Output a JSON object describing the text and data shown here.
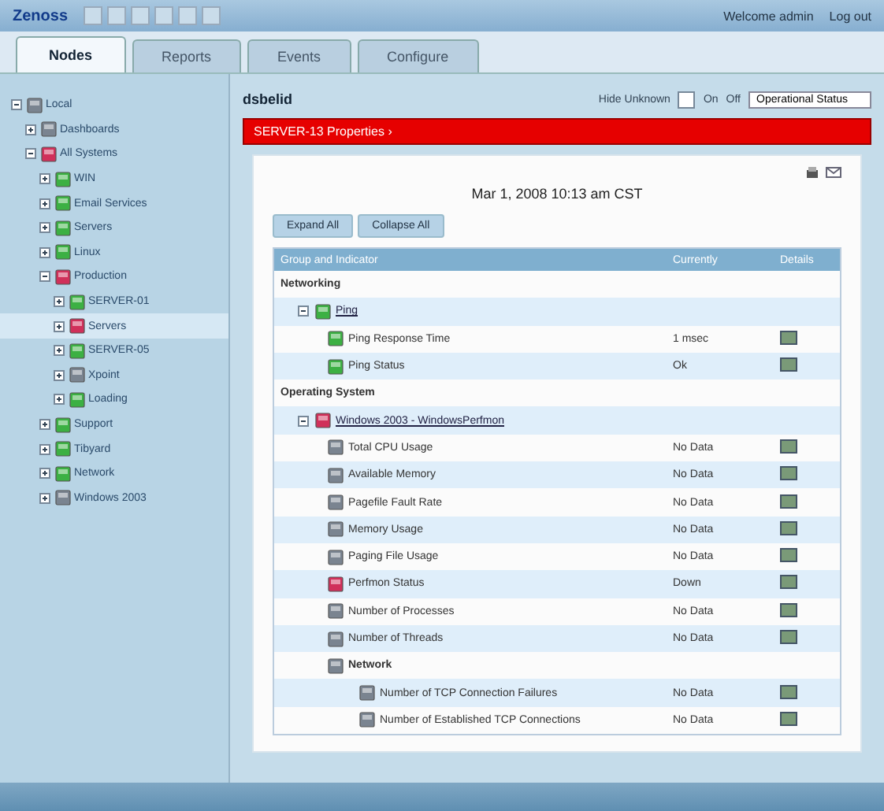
{
  "header": {
    "brand": "Zenoss",
    "user_links": [
      "Welcome admin",
      "Log out"
    ]
  },
  "tabs": [
    {
      "label": "Nodes",
      "selected": true
    },
    {
      "label": "Reports",
      "selected": false
    },
    {
      "label": "Events",
      "selected": false
    },
    {
      "label": "Configure",
      "selected": false
    }
  ],
  "tree": [
    {
      "label": "Local",
      "color": "#7a8490",
      "expanded": true,
      "selected": false,
      "children": [
        {
          "label": "Dashboards",
          "color": "#7a8490",
          "expanded": false,
          "selected": false
        },
        {
          "label": "All Systems",
          "color": "#d0305a",
          "expanded": true,
          "selected": false,
          "children": [
            {
              "label": "WIN",
              "color": "#3cb043",
              "expanded": false,
              "selected": false
            },
            {
              "label": "Email Services",
              "color": "#3cb043",
              "expanded": false,
              "selected": false
            },
            {
              "label": "Servers",
              "color": "#3cb043",
              "expanded": false,
              "selected": false
            },
            {
              "label": "Linux",
              "color": "#3cb043",
              "expanded": false,
              "selected": false
            },
            {
              "label": "Production",
              "color": "#d0305a",
              "expanded": true,
              "selected": false,
              "children": [
                {
                  "label": "SERVER-01",
                  "color": "#3cb043",
                  "expanded": false,
                  "selected": false
                },
                {
                  "label": "Servers",
                  "color": "#d0305a",
                  "expanded": false,
                  "selected": true
                },
                {
                  "label": "SERVER-05",
                  "color": "#3cb043",
                  "expanded": false,
                  "selected": false
                },
                {
                  "label": "Xpoint",
                  "color": "#7a8490",
                  "expanded": false,
                  "selected": false
                },
                {
                  "label": "Loading",
                  "color": "#3cb043",
                  "expanded": false,
                  "selected": false
                }
              ]
            },
            {
              "label": "Support",
              "color": "#3cb043",
              "expanded": false,
              "selected": false
            },
            {
              "label": "Tibyard",
              "color": "#3cb043",
              "expanded": false,
              "selected": false
            },
            {
              "label": "Network",
              "color": "#3cb043",
              "expanded": false,
              "selected": false
            },
            {
              "label": "Windows 2003",
              "color": "#7a8490",
              "expanded": false,
              "selected": false
            }
          ]
        }
      ]
    }
  ],
  "panel": {
    "title": "dsbelid",
    "hide_unknown_label": "Hide Unknown",
    "on_label": "On",
    "off_label": "Off",
    "hide_unknown": false,
    "sort_select": "Operational Status",
    "alert_bar": "SERVER-13  Properties  ›",
    "date": "Mar 1, 2008 10:13 am CST",
    "buttons": [
      "Expand All",
      "Collapse All"
    ],
    "table": {
      "columns": [
        "Group and Indicator",
        "Currently",
        "Details"
      ],
      "rows": [
        {
          "kind": "group",
          "label": "Networking",
          "children": [
            {
              "kind": "host",
              "label": "Ping",
              "color": "#3cb043",
              "expanded": true,
              "children": [
                {
                  "kind": "metric",
                  "label": "Ping Response Time",
                  "color": "#3cb043",
                  "value": "1 msec"
                },
                {
                  "kind": "metric",
                  "label": "Ping Status",
                  "color": "#3cb043",
                  "value": "Ok"
                }
              ]
            }
          ]
        },
        {
          "kind": "group",
          "label": "Operating System",
          "children": [
            {
              "kind": "host",
              "label": "Windows 2003 - WindowsPerfmon",
              "color": "#d0305a",
              "expanded": true,
              "children": [
                {
                  "kind": "metric",
                  "label": "Total CPU Usage",
                  "color": "#7a8490",
                  "value": "No Data"
                },
                {
                  "kind": "metric",
                  "label": "Available Memory",
                  "color": "#7a8490",
                  "value": "No Data"
                },
                {
                  "kind": "metric",
                  "label": "Pagefile Fault Rate",
                  "color": "#7a8490",
                  "value": "No Data"
                },
                {
                  "kind": "metric",
                  "label": "Memory Usage",
                  "color": "#7a8490",
                  "value": "No Data"
                },
                {
                  "kind": "metric",
                  "label": "Paging File Usage",
                  "color": "#7a8490",
                  "value": "No Data"
                },
                {
                  "kind": "metric",
                  "label": "Perfmon Status",
                  "color": "#d0305a",
                  "value": "Down"
                },
                {
                  "kind": "metric",
                  "label": "Number of Processes",
                  "color": "#7a8490",
                  "value": "No Data"
                },
                {
                  "kind": "metric",
                  "label": "Number of Threads",
                  "color": "#7a8490",
                  "value": "No Data"
                },
                {
                  "kind": "subgroup",
                  "label": "Network",
                  "color": "#7a8490",
                  "children": [
                    {
                      "kind": "metric",
                      "label": "Number of TCP Connection Failures",
                      "color": "#7a8490",
                      "value": "No Data"
                    },
                    {
                      "kind": "metric",
                      "label": "Number of Established TCP Connections",
                      "color": "#7a8490",
                      "value": "No Data"
                    }
                  ]
                }
              ]
            }
          ]
        }
      ]
    }
  }
}
